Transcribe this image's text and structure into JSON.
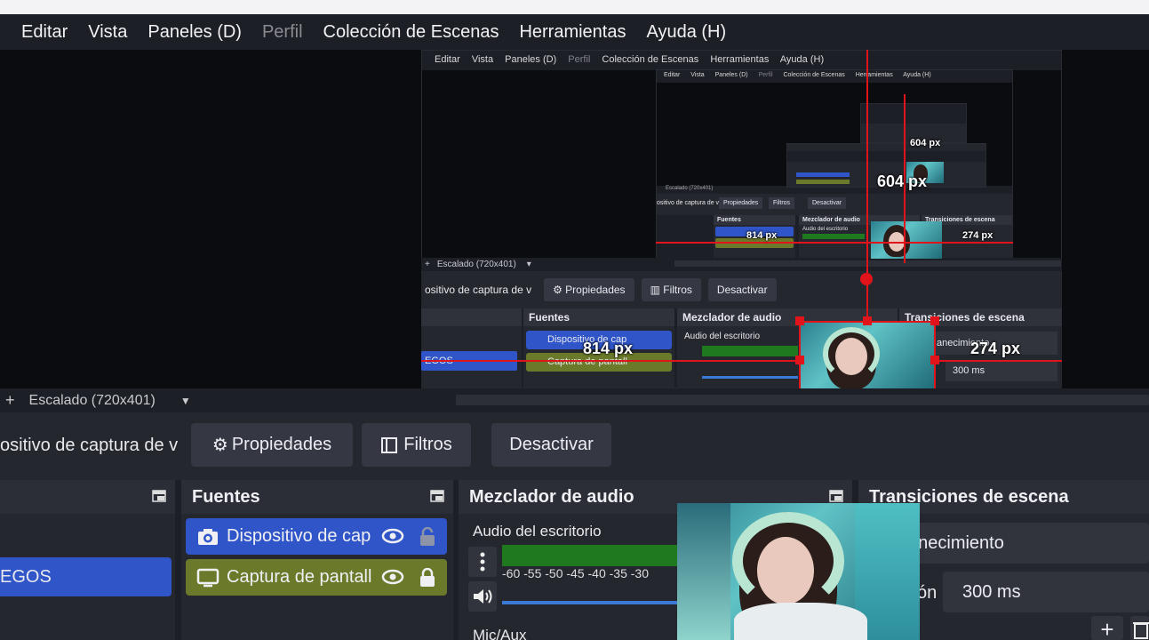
{
  "menu": {
    "items": [
      "Editar",
      "Vista",
      "Paneles (D)",
      "Perfil",
      "Colección de Escenas",
      "Herramientas",
      "Ayuda (H)"
    ]
  },
  "preview": {
    "nested_menu_items": [
      "Editar",
      "Vista",
      "Paneles (D)",
      "Perfil",
      "Colección de Escenas",
      "Herramientas",
      "Ayuda (H)"
    ],
    "mini_scene_label": "Escalado (720x401)",
    "mini_source_label": "ositivo de captura de v",
    "mini_properties": "Propiedades",
    "mini_filters": "Filtros",
    "mini_deactivate": "Desactivar",
    "mini_sources_title": "Fuentes",
    "mini_mixer_title": "Mezclador de audio",
    "mini_transitions_title": "Transiciones de escena",
    "mini_source_1": "Dispositivo de cap",
    "mini_source_2": "Captura de pantall",
    "mini_desktop_audio": "Audio del escritorio",
    "mini_scene_item": "EGOS",
    "mini_fade": "anecimiento",
    "mini_duration": "300 ms",
    "measure_814": "814 px",
    "measure_274": "274 px",
    "measure_604": "604 px"
  },
  "scenebar": {
    "add": "+",
    "label": "Escalado (720x401)"
  },
  "toolbar": {
    "source_label": "ositivo de captura de v",
    "properties": "Propiedades",
    "filters": "Filtros",
    "deactivate": "Desactivar"
  },
  "scenes_dock": {
    "selected_item": "EGOS"
  },
  "sources_dock": {
    "title": "Fuentes",
    "items": [
      "Dispositivo de cap",
      "Captura de pantall"
    ]
  },
  "mixer_dock": {
    "title": "Mezclador de audio",
    "channel_1": "Audio del escritorio",
    "ticks": "-60  -55  -50  -45  -40  -35  -30",
    "channel_2": "Mic/Aux"
  },
  "transitions_dock": {
    "title": "Transiciones de escena",
    "transition": "anecimiento",
    "duration_label": "ón",
    "duration": "300 ms",
    "add": "+"
  },
  "colors": {
    "accent_blue": "#2f55c8",
    "source_green": "#6b7a2a",
    "measure_red": "#e0141a"
  }
}
